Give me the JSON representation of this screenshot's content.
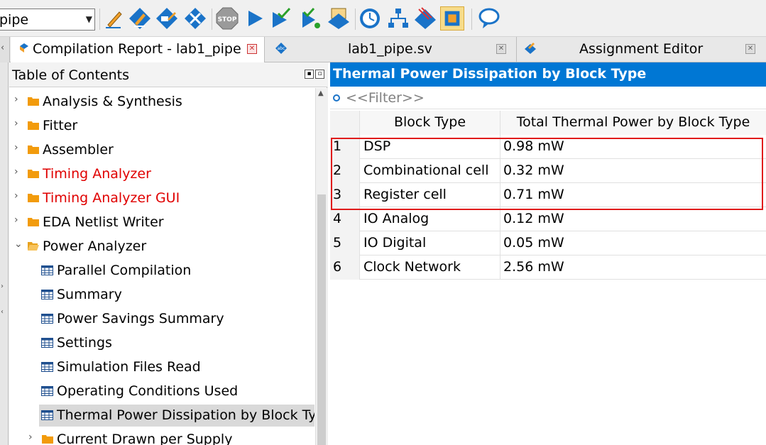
{
  "toolbar": {
    "project_select": "pipe",
    "icons": [
      "pencil-icon",
      "analysis-icon",
      "synthesis-icon",
      "fitter-icon",
      "stop-icon",
      "start-compilation-icon",
      "analysis-check-icon",
      "start-analysis-icon",
      "assembler-icon",
      "timing-analyzer-icon",
      "netlist-viewer-icon",
      "pin-planner-icon",
      "chip-planner-icon",
      "help-bubble-icon"
    ]
  },
  "tabs": [
    {
      "label": "Compilation Report - lab1_pipe",
      "active": true
    },
    {
      "label": "lab1_pipe.sv",
      "active": false
    },
    {
      "label": "Assignment Editor",
      "active": false
    }
  ],
  "toc": {
    "title": "Table of Contents",
    "items": [
      {
        "label": "Analysis & Synthesis",
        "level": 0,
        "type": "folder",
        "expanded": false,
        "color": "normal"
      },
      {
        "label": "Fitter",
        "level": 0,
        "type": "folder",
        "expanded": false,
        "color": "normal"
      },
      {
        "label": "Assembler",
        "level": 0,
        "type": "folder",
        "expanded": false,
        "color": "normal"
      },
      {
        "label": "Timing Analyzer",
        "level": 0,
        "type": "folder",
        "expanded": false,
        "color": "red"
      },
      {
        "label": "Timing Analyzer GUI",
        "level": 0,
        "type": "folder",
        "expanded": false,
        "color": "red"
      },
      {
        "label": "EDA Netlist Writer",
        "level": 0,
        "type": "folder",
        "expanded": false,
        "color": "normal"
      },
      {
        "label": "Power Analyzer",
        "level": 0,
        "type": "folder",
        "expanded": true,
        "color": "normal"
      },
      {
        "label": "Parallel Compilation",
        "level": 1,
        "type": "table",
        "color": "normal"
      },
      {
        "label": "Summary",
        "level": 1,
        "type": "table",
        "color": "normal"
      },
      {
        "label": "Power Savings Summary",
        "level": 1,
        "type": "table",
        "color": "normal"
      },
      {
        "label": "Settings",
        "level": 1,
        "type": "table",
        "color": "normal"
      },
      {
        "label": "Simulation Files Read",
        "level": 1,
        "type": "table",
        "color": "normal"
      },
      {
        "label": "Operating Conditions Used",
        "level": 1,
        "type": "table",
        "color": "normal"
      },
      {
        "label": "Thermal Power Dissipation by Block Type",
        "level": 1,
        "type": "table",
        "color": "normal",
        "selected": true
      },
      {
        "label": "Current Drawn per Supply",
        "level": 1,
        "type": "folder",
        "expanded": false,
        "color": "normal"
      }
    ]
  },
  "report": {
    "title": "Thermal Power Dissipation by Block Type",
    "filter_placeholder": "<<Filter>>",
    "columns": [
      "",
      "Block Type",
      "Total Thermal Power by Block Type"
    ],
    "rows": [
      {
        "num": "1",
        "block": "DSP",
        "power": "0.98 mW"
      },
      {
        "num": "2",
        "block": "Combinational cell",
        "power": "0.32 mW"
      },
      {
        "num": "3",
        "block": "Register cell",
        "power": "0.71 mW"
      },
      {
        "num": "4",
        "block": "IO Analog",
        "power": "0.12 mW"
      },
      {
        "num": "5",
        "block": "IO Digital",
        "power": "0.05 mW"
      },
      {
        "num": "6",
        "block": "Clock Network",
        "power": "2.56 mW"
      }
    ]
  }
}
